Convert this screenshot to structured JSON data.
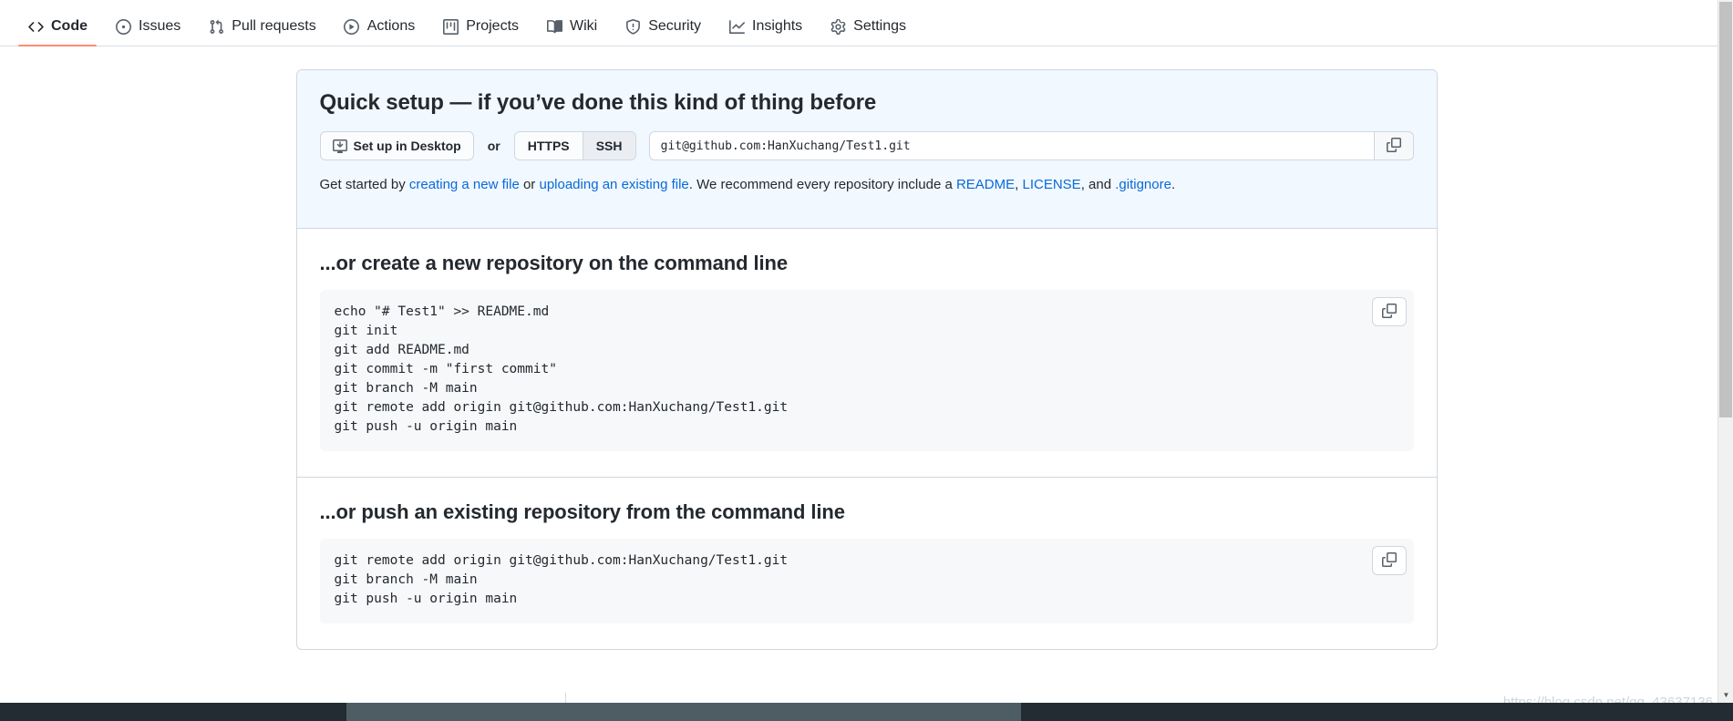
{
  "repo_nav": {
    "items": [
      {
        "label": "Code",
        "icon": "code-icon",
        "active": true
      },
      {
        "label": "Issues",
        "icon": "issue-opened-icon",
        "active": false
      },
      {
        "label": "Pull requests",
        "icon": "git-pull-request-icon",
        "active": false
      },
      {
        "label": "Actions",
        "icon": "play-icon",
        "active": false
      },
      {
        "label": "Projects",
        "icon": "project-board-icon",
        "active": false
      },
      {
        "label": "Wiki",
        "icon": "book-icon",
        "active": false
      },
      {
        "label": "Security",
        "icon": "shield-icon",
        "active": false
      },
      {
        "label": "Insights",
        "icon": "graph-icon",
        "active": false
      },
      {
        "label": "Settings",
        "icon": "gear-icon",
        "active": false
      }
    ],
    "active_underline_color": "#fd8c73"
  },
  "quick_setup": {
    "title": "Quick setup — if you’ve done this kind of thing before",
    "desktop_button": "Set up in Desktop",
    "or_label": "or",
    "protocol_options": [
      "HTTPS",
      "SSH"
    ],
    "protocol_selected": "SSH",
    "clone_url": "git@github.com:HanXuchang/Test1.git",
    "copy_icon": "clipboard-copy-icon",
    "help": {
      "prefix": "Get started by ",
      "link_create": "creating a new file",
      "mid_or": " or ",
      "link_upload": "uploading an existing file",
      "mid_recommend": ". We recommend every repository include a ",
      "link_readme": "README",
      "sep1": ", ",
      "link_license": "LICENSE",
      "sep2": ", and ",
      "link_gitignore": ".gitignore",
      "suffix": "."
    },
    "panel_bg": "#f1f8ff"
  },
  "create_repo_section": {
    "title": "...or create a new repository on the command line",
    "copy_icon": "clipboard-copy-icon",
    "code": "echo \"# Test1\" >> README.md\ngit init\ngit add README.md\ngit commit -m \"first commit\"\ngit branch -M main\ngit remote add origin git@github.com:HanXuchang/Test1.git\ngit push -u origin main"
  },
  "push_repo_section": {
    "title": "...or push an existing repository from the command line",
    "copy_icon": "clipboard-copy-icon",
    "code": "git remote add origin git@github.com:HanXuchang/Test1.git\ngit branch -M main\ngit push -u origin main"
  },
  "watermark": {
    "text": "https://blog.csdn.net/qq_43637136"
  },
  "colors": {
    "accent_link": "#0969da",
    "active_tab_underline": "#fd8c73",
    "border": "#d0d7de",
    "code_bg": "#f6f8fa"
  }
}
